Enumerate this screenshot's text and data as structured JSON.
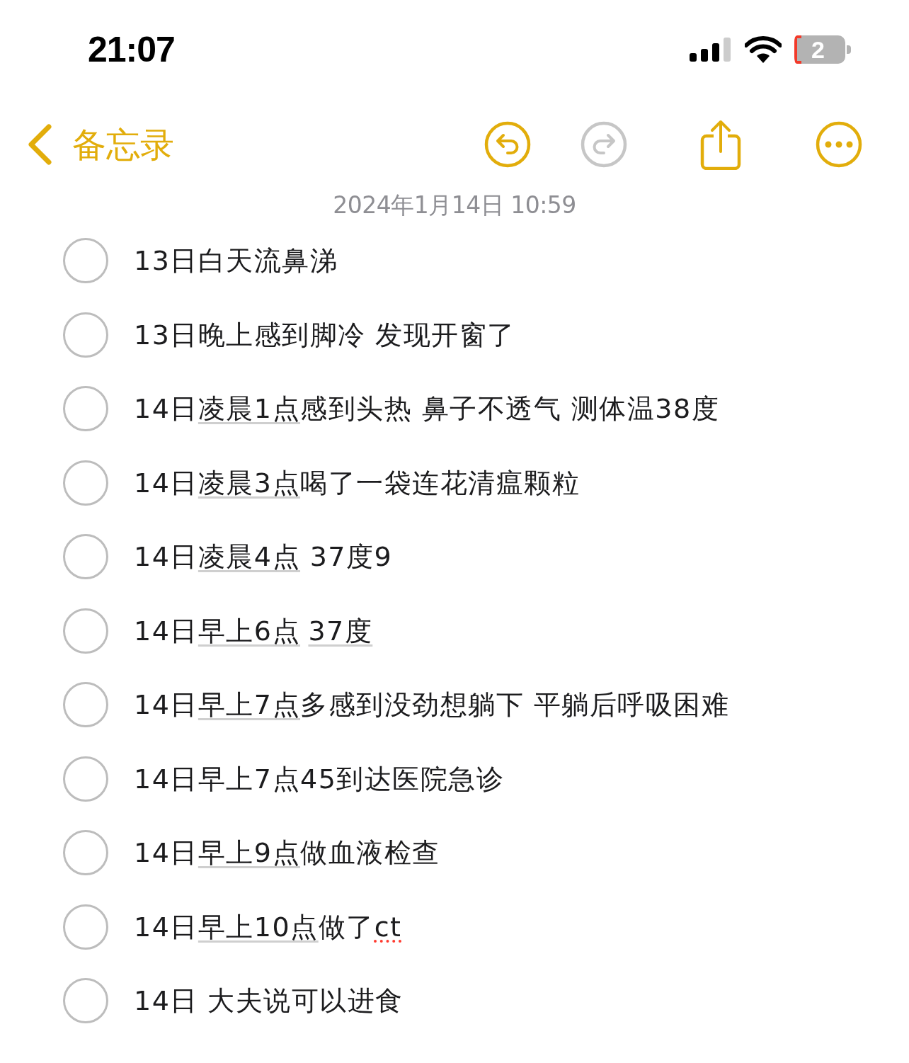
{
  "status_bar": {
    "time": "21:07",
    "battery": "2"
  },
  "nav": {
    "back_label": "备忘录",
    "undo_enabled": true,
    "redo_enabled": false
  },
  "note": {
    "date": "2024年1月14日 10:59",
    "items": [
      {
        "checked": false,
        "segments": [
          {
            "kind": "plain",
            "text": "13日白天流鼻涕"
          }
        ]
      },
      {
        "checked": false,
        "segments": [
          {
            "kind": "plain",
            "text": "13日晚上感到脚冷 发现开窗了"
          }
        ]
      },
      {
        "checked": false,
        "segments": [
          {
            "kind": "plain",
            "text": "14日"
          },
          {
            "kind": "date",
            "text": "凌晨1点"
          },
          {
            "kind": "plain",
            "text": "感到头热 鼻子不透气 测体温38度"
          }
        ]
      },
      {
        "checked": false,
        "segments": [
          {
            "kind": "plain",
            "text": "14日"
          },
          {
            "kind": "date",
            "text": "凌晨3点"
          },
          {
            "kind": "plain",
            "text": "喝了一袋连花清瘟颗粒"
          }
        ]
      },
      {
        "checked": false,
        "segments": [
          {
            "kind": "plain",
            "text": "14日"
          },
          {
            "kind": "date",
            "text": "凌晨4点"
          },
          {
            "kind": "plain",
            "text": " 37度9"
          }
        ]
      },
      {
        "checked": false,
        "segments": [
          {
            "kind": "plain",
            "text": "14日"
          },
          {
            "kind": "date",
            "text": "早上6点"
          },
          {
            "kind": "date",
            "text": "37度",
            "space_before": true
          }
        ]
      },
      {
        "checked": false,
        "segments": [
          {
            "kind": "plain",
            "text": "14日"
          },
          {
            "kind": "date",
            "text": "早上7点"
          },
          {
            "kind": "plain",
            "text": "多感到没劲想躺下 平躺后呼吸困难"
          }
        ]
      },
      {
        "checked": false,
        "segments": [
          {
            "kind": "plain",
            "text": "14日早上7点45到达医院急诊"
          }
        ]
      },
      {
        "checked": false,
        "segments": [
          {
            "kind": "plain",
            "text": "14日"
          },
          {
            "kind": "date",
            "text": "早上9点"
          },
          {
            "kind": "plain",
            "text": "做血液检查"
          }
        ]
      },
      {
        "checked": false,
        "segments": [
          {
            "kind": "plain",
            "text": "14日"
          },
          {
            "kind": "date",
            "text": "早上10点"
          },
          {
            "kind": "plain",
            "text": "做了"
          },
          {
            "kind": "misspelled",
            "text": "ct"
          }
        ]
      },
      {
        "checked": false,
        "segments": [
          {
            "kind": "plain",
            "text": "14日 大夫说可以进食"
          }
        ]
      }
    ]
  }
}
